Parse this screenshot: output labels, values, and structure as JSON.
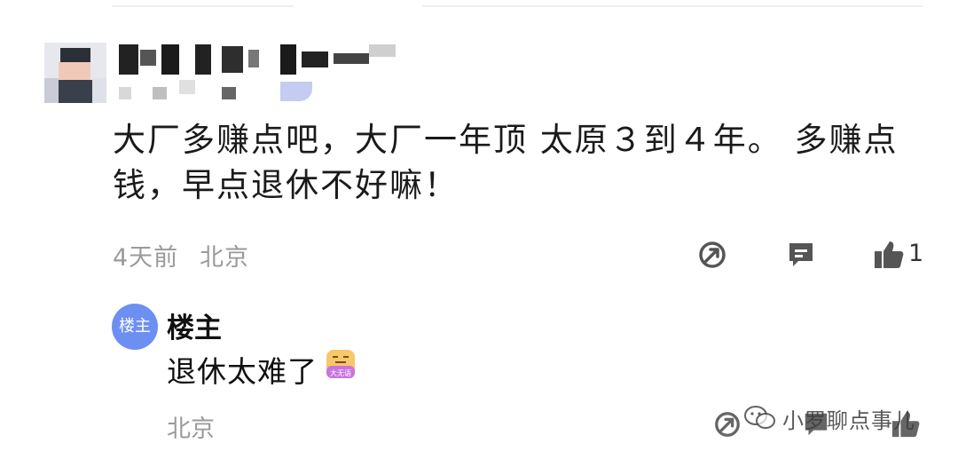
{
  "comment": {
    "text": "大厂多赚点吧，大厂一年顶 太原３到４年。  多赚点钱，早点退休不好嘛！",
    "time": "4天前",
    "location": "北京",
    "like_count": "1"
  },
  "reply": {
    "avatar_label": "楼主",
    "author": "楼主",
    "text": "退休太难了",
    "emoji_label": "大无语",
    "location": "北京"
  },
  "watermark": {
    "text": "小罗聊点事儿"
  },
  "icons": {
    "share": "share-icon",
    "reply": "comment-icon",
    "like": "thumbs-up-icon"
  },
  "colors": {
    "accent": "#6d8ff2",
    "meta_gray": "#9a9a9a",
    "icon_gray": "#555555"
  }
}
